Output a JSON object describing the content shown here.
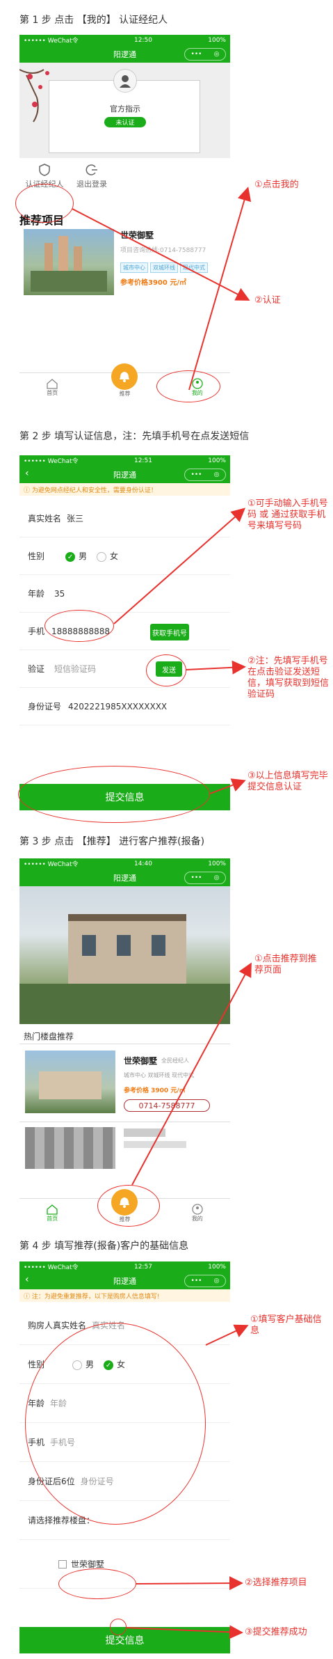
{
  "steps": {
    "s1": "第 1 步  点击 【我的】 认证经纪人",
    "s2": "第 2 步  填写认证信息，注：先填手机号在点发送短信",
    "s3": "第 3 步  点击 【推荐】 进行客户推荐(报备)",
    "s4": "第 4 步  填写推荐(报备)客户的基础信息"
  },
  "status": {
    "carrier": "•••••• WeChat令",
    "battery": "100%"
  },
  "times": {
    "t1": "12:50",
    "t2": "12:51",
    "t3": "14:40",
    "t4": "12:57"
  },
  "app_title": "阳逻通",
  "capsule_dots": "•••",
  "capsule_ring": "◎",
  "s1": {
    "user_name": "官方指示",
    "badge": "未认证",
    "menu_cert": "认证经纪人",
    "menu_logout": "退出登录",
    "section": "推荐项目",
    "proj_name": "世荣御墅",
    "proj_tel": "项目咨询热线:0714-7588777",
    "tags": [
      "城市中心",
      "双城环线",
      "现代中式"
    ],
    "price": "参考价格3900 元/㎡",
    "tab_home": "首页",
    "tab_rec": "推荐",
    "tab_me": "我的"
  },
  "s2": {
    "notice": "为避免网点经纪人和安全性，需要身份认证！",
    "name_label": "真实姓名",
    "name_val": "张三",
    "gender_label": "性别",
    "male": "男",
    "female": "女",
    "age_label": "年龄",
    "age_val": "35",
    "phone_label": "手机",
    "phone_val": "18888888888",
    "get_phone": "获取手机号",
    "code_label": "验证",
    "code_ph": "短信验证码",
    "send": "发送",
    "id_label": "身份证号",
    "id_val": "4202221985XXXXXXXX",
    "submit": "提交信息"
  },
  "s3": {
    "section": "热门楼盘推荐",
    "proj_name": "世荣御墅",
    "proj_sub": "全民经纪人",
    "tags": [
      "城市中心",
      "双城环线",
      "现代中式"
    ],
    "price": "参考价格 3900 元/㎡",
    "tel": "0714-7588777",
    "tab_home": "首页",
    "tab_rec": "推荐",
    "tab_me": "我的"
  },
  "s4": {
    "notice": "注：为避免重复推荐，以下是购房人信息填写!",
    "name_label": "购房人真实姓名",
    "name_ph": "真实姓名",
    "gender_label": "性别",
    "male": "男",
    "female": "女",
    "age_label": "年龄",
    "age_ph": "年龄",
    "phone_label": "手机",
    "phone_ph": "手机号",
    "id_label": "身份证后6位",
    "id_ph": "身份证号",
    "choose_label": "请选择推荐楼盘：",
    "proj": "世荣御墅",
    "submit": "提交信息"
  },
  "annotations": {
    "a1": "①点击我的",
    "a2": "②认证",
    "a3": "①可手动输入手机号码 或 通过获取手机号来填写号码",
    "a4": "②注：先填写手机号在点击验证发送短信，填写获取到短信验证码",
    "a5": "③以上信息填写完毕提交信息认证",
    "a6": "①点击推荐到推荐页面",
    "a7": "①填写客户基础信息",
    "a8": "②选择推荐项目",
    "a9": "③提交推荐成功"
  },
  "colors": {
    "green": "#1aad19",
    "red": "#e8322d",
    "orange": "#f5a623"
  }
}
